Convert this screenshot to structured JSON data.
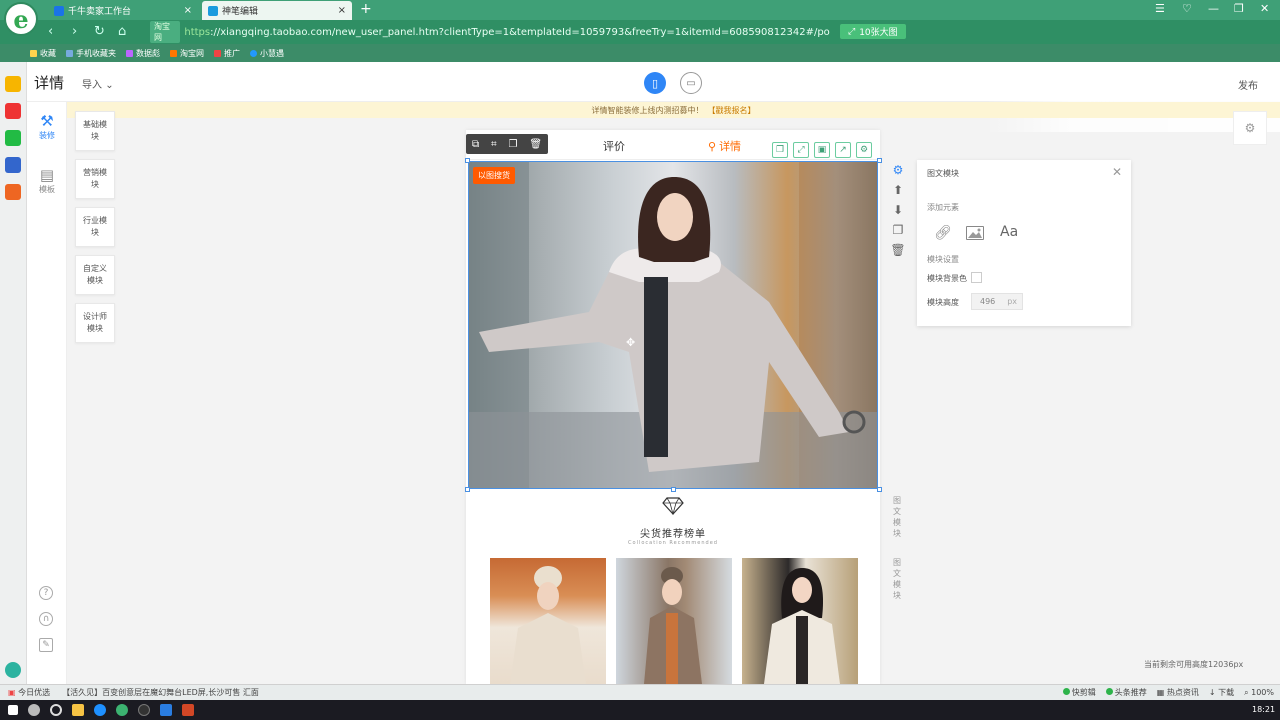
{
  "browser": {
    "tabs": [
      {
        "label": "千牛卖家工作台"
      },
      {
        "label": "神笔编辑"
      }
    ],
    "url_site": "淘宝网",
    "url_scheme": "https",
    "url_rest": "://xiangqing.taobao.com/new_user_panel.htm?clientType=1&templateId=1059793&freeTry=1&itemId=608590812342#/polish/mobi",
    "big_image_label": "10张大图",
    "bookmarks": [
      "收藏",
      "手机收藏夹",
      "数据彪",
      "淘宝网",
      "推广",
      "小慧遇"
    ]
  },
  "header": {
    "title": "详情",
    "import_label": "导入",
    "publish_label": "发布"
  },
  "notice": {
    "text": "详情智能装修上线内测招募中！",
    "link": "【戳我报名】"
  },
  "tools": [
    {
      "label": "装修"
    },
    {
      "label": "模板"
    }
  ],
  "modules": [
    "基础模块",
    "营销模块",
    "行业模块",
    "自定义模块",
    "设计师模块"
  ],
  "canvas": {
    "tab_review": "评价",
    "tab_detail": "详情",
    "tag": "以图搜货",
    "rec_title": "尖货推荐榜单",
    "rec_subtitle": "Collocation Recommended",
    "side_labels": [
      "图文模块",
      "图文模块"
    ]
  },
  "panel": {
    "title": "图文模块",
    "add_elements": "添加元素",
    "module_settings": "模块设置",
    "bg_color_label": "模块背景色",
    "height_label": "模块高度",
    "height_value": "496",
    "height_unit": "px"
  },
  "footer": {
    "remaining": "当前剩余可用高度12036px"
  },
  "statusbar": {
    "left_items": [
      "今日优选",
      "【活久见】百变创意层在魔幻舞台LED屏,长沙可售 汇面"
    ],
    "right_items": [
      "快剪辑",
      "头条推荐",
      "热点资讯",
      "下载",
      "100%"
    ]
  },
  "taskbar": {
    "clock": "18:21"
  },
  "colors": {
    "browser_green": "#3fa077",
    "accent_blue": "#2f86f6",
    "accent_orange": "#ff6a00",
    "tag_orange": "#ff5a00"
  }
}
